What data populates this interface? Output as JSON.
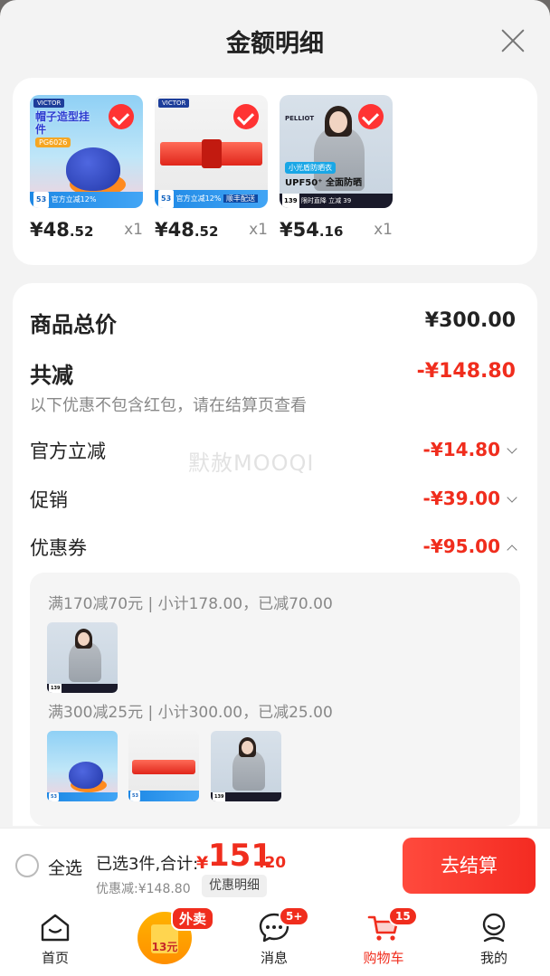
{
  "sheet": {
    "title": "金额明细"
  },
  "products": [
    {
      "price_int": "¥48",
      "price_dec": ".52",
      "qty": "x1",
      "art": {
        "logo": "VICTOR",
        "title": "帽子造型挂件",
        "code": "PG6026",
        "strip_label": "官方立减12%",
        "strip_num": "53"
      }
    },
    {
      "price_int": "¥48",
      "price_dec": ".52",
      "qty": "x1",
      "art": {
        "logo": "VICTOR",
        "strip_label": "官方立减12%",
        "strip_num": "53",
        "strip_extra": "顺丰配送"
      }
    },
    {
      "price_int": "¥54",
      "price_dec": ".16",
      "qty": "x1",
      "art": {
        "brand": "PELLIOT",
        "tag": "小光盾防晒衣",
        "upf": "UPF50⁺ 全面防晒",
        "bar_price": "139",
        "bar_text": "限时直降 立减 39"
      }
    }
  ],
  "summary": {
    "total_label": "商品总价",
    "total_value": "¥300.00",
    "reduce_label": "共减",
    "reduce_value": "-¥148.80",
    "note": "以下优惠不包含红包，请在结算页查看",
    "official_label": "官方立减",
    "official_value": "-¥14.80",
    "promo_label": "促销",
    "promo_value": "-¥39.00",
    "coupon_label": "优惠券",
    "coupon_value": "-¥95.00"
  },
  "coupons": [
    {
      "text": "满170减70元 | 小计178.00，已减70.00"
    },
    {
      "text": "满300减25元 | 小计300.00，已减25.00"
    }
  ],
  "watermark": "默赦MOOQI",
  "checkout": {
    "select_all": "全选",
    "selected_text": "已选3件,合计:",
    "total_symbol": "¥",
    "total_int": "151",
    "total_dec": ".20",
    "discount_text": "优惠减:¥148.80",
    "detail_label": "优惠明细",
    "button_label": "去结算"
  },
  "tabbar": {
    "home": "首页",
    "waimai_badge": "外卖",
    "waimai_amount": "13元",
    "messages": "消息",
    "messages_badge": "5+",
    "cart": "购物车",
    "cart_badge": "15",
    "mine": "我的"
  },
  "colors": {
    "accent": "#f02d1d",
    "check": "#ff3333"
  }
}
